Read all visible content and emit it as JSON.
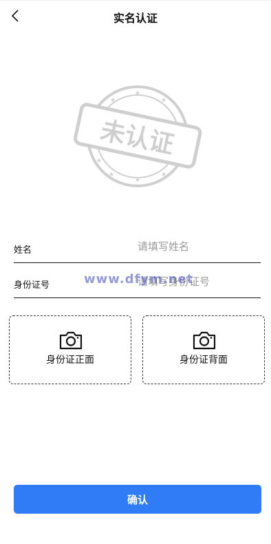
{
  "header": {
    "title": "实名认证"
  },
  "stamp": {
    "text": "未认证"
  },
  "form": {
    "name_label": "姓名",
    "name_placeholder": "请填写姓名",
    "id_label": "身份证号",
    "id_placeholder": "请填写身份证号"
  },
  "watermark": "www.dfym.net",
  "uploads": {
    "front_label": "身份证正面",
    "back_label": "身份证背面"
  },
  "confirm_label": "确认",
  "colors": {
    "primary": "#2f7cf6",
    "stamp": "#cccccc",
    "placeholder": "#9a9a9a"
  }
}
